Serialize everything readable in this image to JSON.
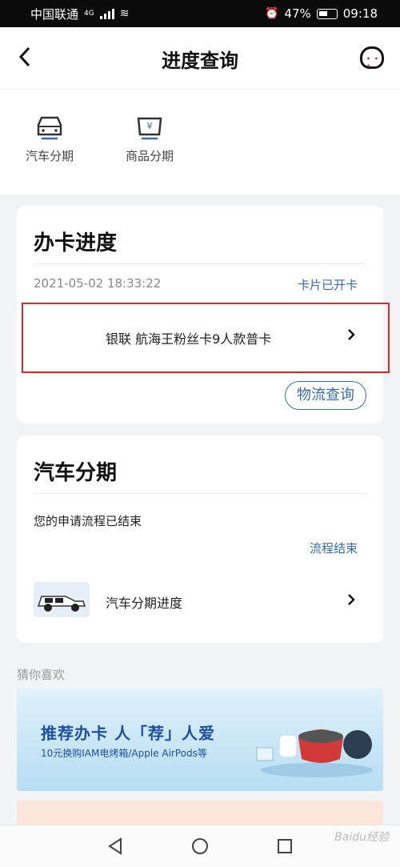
{
  "status_bar": {
    "carrier": "中国联通",
    "network": "4G",
    "battery": "47%",
    "time": "09:18"
  },
  "header": {
    "title": "进度查询"
  },
  "categories": [
    {
      "label": "汽车分期",
      "icon": "car-icon"
    },
    {
      "label": "商品分期",
      "icon": "shopping-basket-yuan-icon"
    }
  ],
  "card_progress": {
    "title": "办卡进度",
    "timestamp": "2021-05-02 18:33:22",
    "status": "卡片已开卡",
    "card_name": "银联 航海王粉丝卡9人款普卡",
    "logistics_button": "物流查询"
  },
  "car_loan": {
    "title": "汽车分期",
    "message": "您的申请流程已结束",
    "status": "流程结束",
    "item_label": "汽车分期进度"
  },
  "recommend": {
    "section_label": "猜你喜欢",
    "banner_title": "推荐办卡 人「荐」人爱",
    "banner_subtitle": "10元换购IAM电烤箱/Apple AirPods等"
  },
  "watermark": "Baidu经验",
  "colors": {
    "accent_blue": "#3a6ab0",
    "highlight_red": "#d52b2b"
  }
}
